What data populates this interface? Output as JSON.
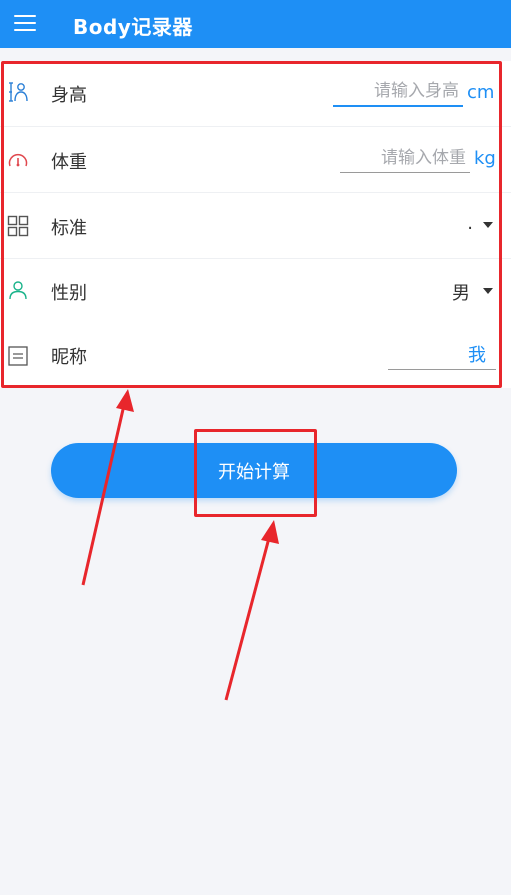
{
  "app": {
    "title": "Body记录器",
    "menu_icon": "menu-icon"
  },
  "form": {
    "height": {
      "label": "身高",
      "placeholder": "请输入身高",
      "value": "",
      "unit": "cm",
      "icon": "person-height-icon"
    },
    "weight": {
      "label": "体重",
      "placeholder": "请输入体重",
      "value": "",
      "unit": "kg",
      "icon": "gauge-icon"
    },
    "standard": {
      "label": "标准",
      "selected": ".",
      "icon": "grid-icon"
    },
    "gender": {
      "label": "性别",
      "selected": "男",
      "icon": "person-icon"
    },
    "nickname": {
      "label": "昵称",
      "value": "我",
      "icon": "document-icon"
    }
  },
  "actions": {
    "calculate_label": "开始计算"
  },
  "colors": {
    "primary": "#1e8ff5",
    "annotation": "#e8262c",
    "background": "#f4f5f9"
  }
}
